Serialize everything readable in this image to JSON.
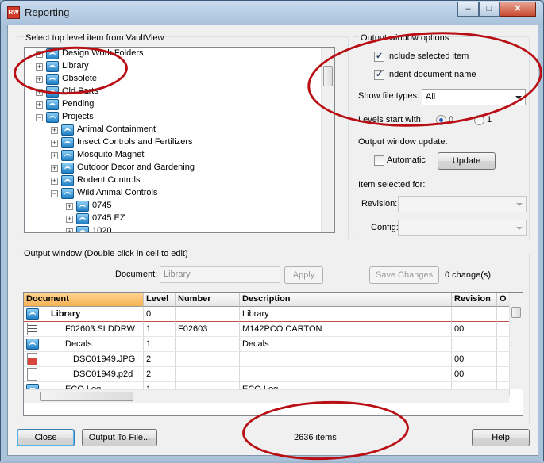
{
  "window": {
    "title": "Reporting",
    "icon_text": "RW",
    "min_glyph": "–",
    "max_glyph": "□",
    "close_glyph": "✕"
  },
  "tree_panel": {
    "label": "Select top level item from VaultView",
    "items": [
      {
        "label": "Design Work Folders",
        "level": 0
      },
      {
        "label": "Library",
        "level": 0
      },
      {
        "label": "Obsolete",
        "level": 0
      },
      {
        "label": "Old Parts",
        "level": 0
      },
      {
        "label": "Pending",
        "level": 0
      },
      {
        "label": "Projects",
        "level": 0
      },
      {
        "label": "Animal Containment",
        "level": 1
      },
      {
        "label": "Insect Controls and Fertilizers",
        "level": 1
      },
      {
        "label": "Mosquito Magnet",
        "level": 1
      },
      {
        "label": "Outdoor Decor and Gardening",
        "level": 1
      },
      {
        "label": "Rodent Controls",
        "level": 1
      },
      {
        "label": "Wild Animal Controls",
        "level": 1
      },
      {
        "label": "0745",
        "level": 2
      },
      {
        "label": "0745 EZ",
        "level": 2
      },
      {
        "label": "1020",
        "level": 2
      }
    ]
  },
  "options": {
    "group_label": "Output window options",
    "include_selected": {
      "label": "Include selected item",
      "checked": true
    },
    "indent_name": {
      "label": "Indent document name",
      "checked": true
    },
    "show_file_types_label": "Show file types:",
    "show_file_types_value": "All",
    "levels_start_label": "Levels start with:",
    "level_options": [
      "0",
      "1"
    ],
    "level_selected": "0",
    "update_label": "Output window update:",
    "automatic": {
      "label": "Automatic",
      "checked": false
    },
    "update_button": "Update",
    "item_selected_label": "Item selected for:",
    "revision_label": "Revision:",
    "config_label": "Config:"
  },
  "output": {
    "group_label": "Output window (Double click in cell to edit)",
    "document_label": "Document:",
    "document_value": "Library",
    "apply_button": "Apply",
    "save_changes_button": "Save Changes",
    "changes_text": "0 change(s)",
    "columns": [
      "Document",
      "Level",
      "Number",
      "Description",
      "Revision",
      "O"
    ],
    "rows": [
      {
        "icon": "folder-icon",
        "document": "Library",
        "level": "0",
        "number": "",
        "description": "Library",
        "revision": "",
        "bold": true
      },
      {
        "icon": "drawing-icon",
        "document": "F02603.SLDDRW",
        "level": "1",
        "number": "F02603",
        "description": "M142PCO CARTON",
        "revision": "00",
        "bold": false
      },
      {
        "icon": "folder-icon",
        "document": "Decals",
        "level": "1",
        "number": "",
        "description": "Decals",
        "revision": "",
        "bold": false
      },
      {
        "icon": "image-icon",
        "document": "DSC01949.JPG",
        "level": "2",
        "number": "",
        "description": "",
        "revision": "00",
        "bold": false
      },
      {
        "icon": "document-icon",
        "document": "DSC01949.p2d",
        "level": "2",
        "number": "",
        "description": "",
        "revision": "00",
        "bold": false
      },
      {
        "icon": "folder-icon",
        "document": "ECO Log",
        "level": "1",
        "number": "",
        "description": "ECO Log",
        "revision": "",
        "bold": false
      }
    ]
  },
  "footer": {
    "close_button": "Close",
    "output_file_button": "Output To File...",
    "item_count": "2636 items",
    "help_button": "Help"
  },
  "colors": {
    "annotation_red": "#b80e14",
    "header_highlight": "#f5b253",
    "accent_blue": "#245cb8"
  }
}
